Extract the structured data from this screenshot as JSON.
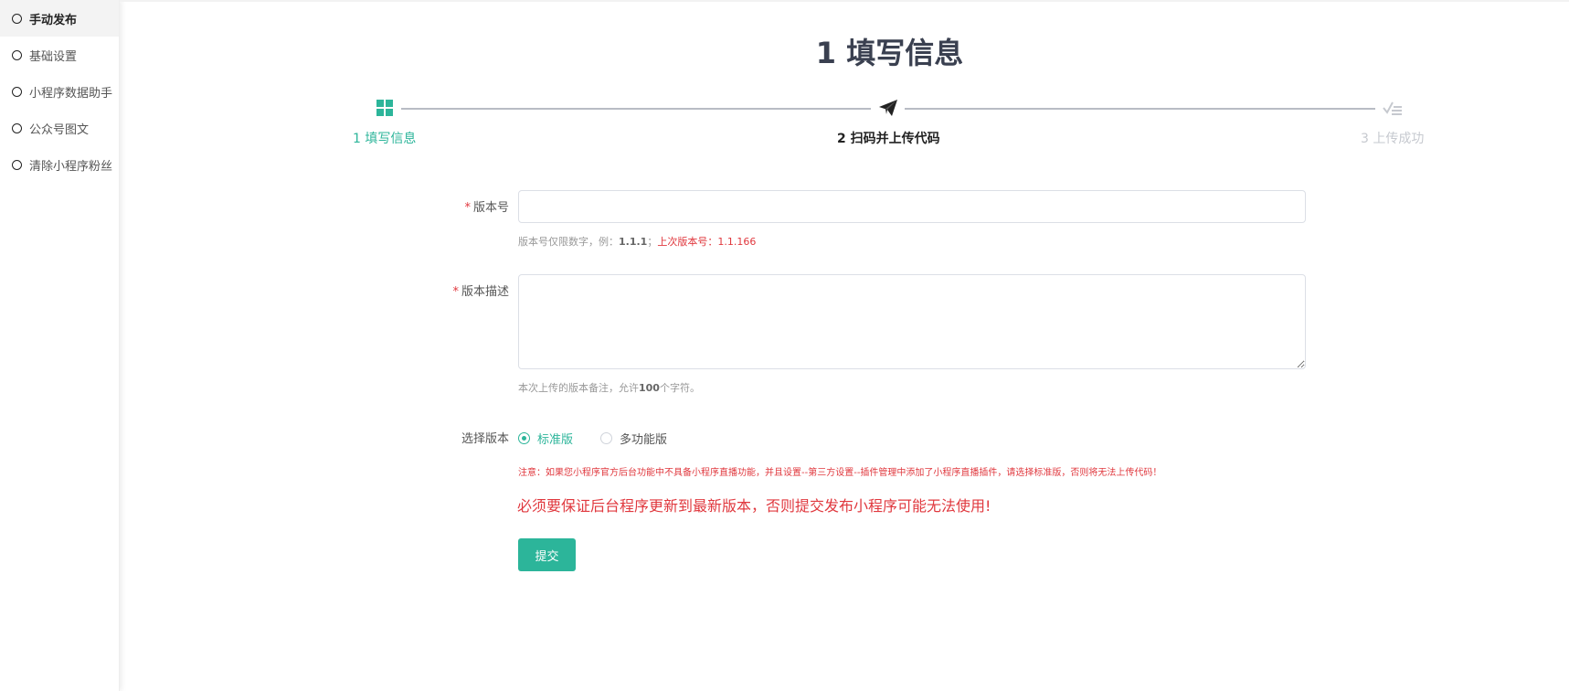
{
  "sidebar": {
    "items": [
      {
        "label": "手动发布",
        "active": true
      },
      {
        "label": "基础设置",
        "active": false
      },
      {
        "label": "小程序数据助手",
        "active": false
      },
      {
        "label": "公众号图文",
        "active": false
      },
      {
        "label": "清除小程序粉丝",
        "active": false
      }
    ]
  },
  "page": {
    "title": "1 填写信息"
  },
  "steps": [
    {
      "label": "1 填写信息",
      "icon": "grid-icon",
      "state": "done"
    },
    {
      "label": "2 扫码并上传代码",
      "icon": "paper-plane-icon",
      "state": "current"
    },
    {
      "label": "3 上传成功",
      "icon": "checklist-icon",
      "state": "pending"
    }
  ],
  "form": {
    "version": {
      "required_mark": "*",
      "label": "版本号",
      "value": "",
      "placeholder": "",
      "hint_prefix": "版本号仅限数字，例：",
      "hint_example": "1.1.1",
      "hint_sep": "；",
      "hint_last": "上次版本号：1.1.166"
    },
    "description": {
      "required_mark": "*",
      "label": "版本描述",
      "value": "",
      "hint_prefix": "本次上传的版本备注，允许",
      "hint_count": "100",
      "hint_suffix": "个字符。"
    },
    "edition": {
      "label": "选择版本",
      "options": [
        {
          "label": "标准版",
          "checked": true
        },
        {
          "label": "多功能版",
          "checked": false
        }
      ],
      "note": "注意：如果您小程序官方后台功能中不具备小程序直播功能，并且设置--第三方设置--插件管理中添加了小程序直播插件，请选择标准版，否则将无法上传代码！",
      "warning": "必须要保证后台程序更新到最新版本，否则提交发布小程序可能无法使用!"
    },
    "submit_label": "提交"
  },
  "colors": {
    "accent": "#2cb59a",
    "danger": "#e0383e",
    "title": "#3a4050"
  }
}
